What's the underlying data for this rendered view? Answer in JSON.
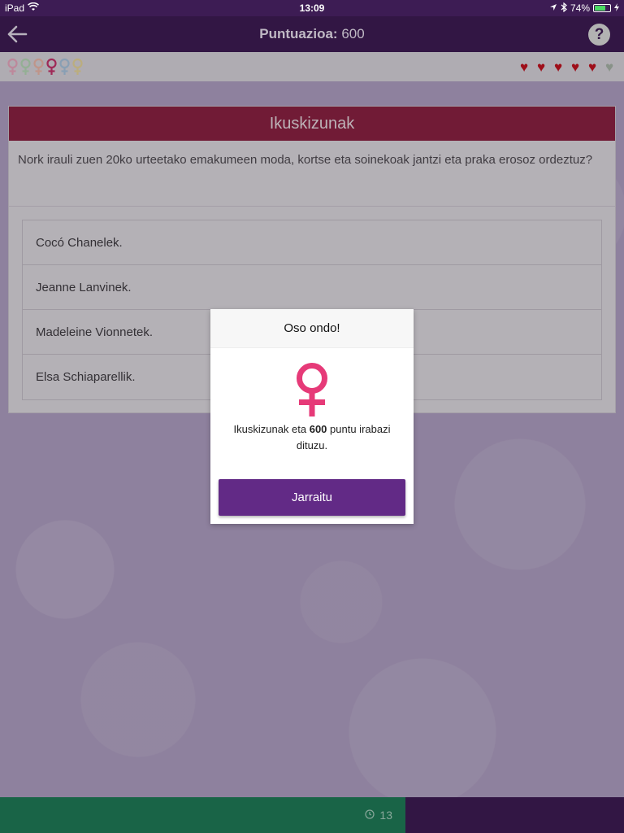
{
  "status_bar": {
    "device": "iPad",
    "time": "13:09",
    "battery_percent": "74%",
    "battery_level": 0.74
  },
  "header": {
    "title_label": "Puntuazioa:",
    "score": "600",
    "help_label": "?"
  },
  "progress": {
    "venus_icons": [
      {
        "color": "#e7a7bd"
      },
      {
        "color": "#b5d6b6"
      },
      {
        "color": "#e9b6a9"
      },
      {
        "color": "#c2326b"
      },
      {
        "color": "#a8c3dc"
      },
      {
        "color": "#e5d49a"
      }
    ],
    "hearts": [
      {
        "color": "#c1121f"
      },
      {
        "color": "#c1121f"
      },
      {
        "color": "#c1121f"
      },
      {
        "color": "#c1121f"
      },
      {
        "color": "#c1121f"
      },
      {
        "color": "#a7b3a7"
      }
    ]
  },
  "card": {
    "category": "Ikuskizunak",
    "question": "Nork irauli zuen 20ko urteetako emakumeen moda, kortse eta soinekoak jantzi eta praka erosoz ordeztuz?",
    "answers": [
      "Cocó Chanelek.",
      "Jeanne Lanvinek.",
      "Madeleine Vionnetek.",
      "Elsa Schiaparellik."
    ]
  },
  "modal": {
    "title": "Oso ondo!",
    "message_before": "Ikuskizunak eta ",
    "points": "600",
    "message_after": " puntu irabazi dituzu.",
    "button_label": "Jarraitu",
    "icon_color": "#e63a78"
  },
  "footer": {
    "timer_value": "13",
    "time_fraction_elapsed": 0.65
  },
  "colors": {
    "header_bg": "#3d1c54",
    "category_bg": "#8a2143",
    "button_bg": "#622a86",
    "timer_bg": "#1f7a57"
  }
}
